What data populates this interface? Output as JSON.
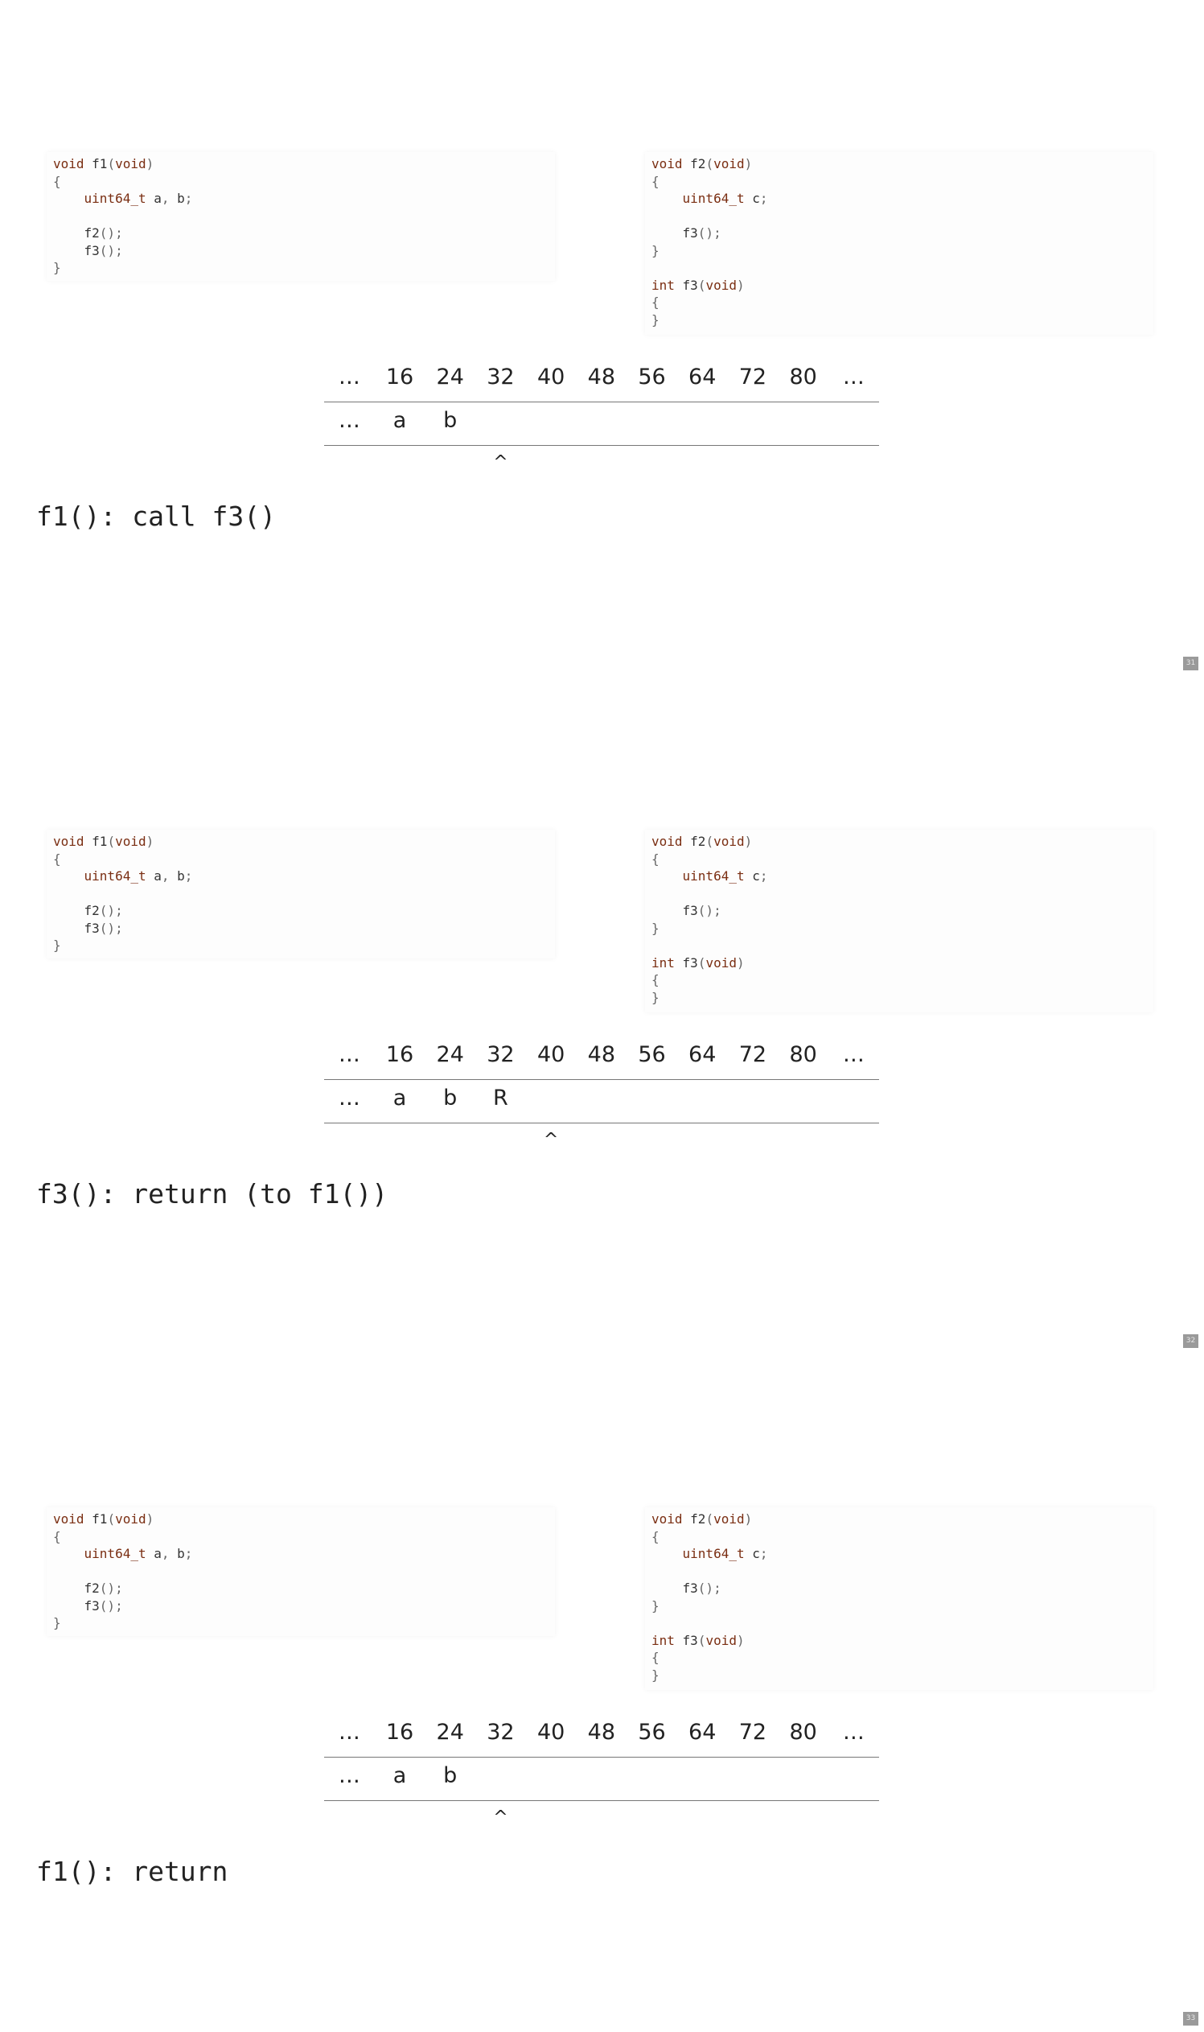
{
  "code": {
    "f1": [
      {
        "segs": [
          {
            "t": "void",
            "c": "kw"
          },
          {
            "t": " f1",
            "c": ""
          },
          {
            "t": "(",
            "c": "punc"
          },
          {
            "t": "void",
            "c": "kw"
          },
          {
            "t": ")",
            "c": "punc"
          }
        ]
      },
      {
        "segs": [
          {
            "t": "{",
            "c": "punc"
          }
        ]
      },
      {
        "segs": [
          {
            "t": "    ",
            "c": ""
          },
          {
            "t": "uint64_t",
            "c": "kw"
          },
          {
            "t": " a",
            "c": ""
          },
          {
            "t": ",",
            "c": "punc"
          },
          {
            "t": " b",
            "c": ""
          },
          {
            "t": ";",
            "c": "punc"
          }
        ]
      },
      {
        "segs": []
      },
      {
        "segs": [
          {
            "t": "    f2",
            "c": ""
          },
          {
            "t": "();",
            "c": "punc"
          }
        ]
      },
      {
        "segs": [
          {
            "t": "    f3",
            "c": ""
          },
          {
            "t": "();",
            "c": "punc"
          }
        ]
      },
      {
        "segs": [
          {
            "t": "}",
            "c": "punc"
          }
        ]
      }
    ],
    "f2f3": [
      {
        "segs": [
          {
            "t": "void",
            "c": "kw"
          },
          {
            "t": " f2",
            "c": ""
          },
          {
            "t": "(",
            "c": "punc"
          },
          {
            "t": "void",
            "c": "kw"
          },
          {
            "t": ")",
            "c": "punc"
          }
        ]
      },
      {
        "segs": [
          {
            "t": "{",
            "c": "punc"
          }
        ]
      },
      {
        "segs": [
          {
            "t": "    ",
            "c": ""
          },
          {
            "t": "uint64_t",
            "c": "kw"
          },
          {
            "t": " c",
            "c": ""
          },
          {
            "t": ";",
            "c": "punc"
          }
        ]
      },
      {
        "segs": []
      },
      {
        "segs": [
          {
            "t": "    f3",
            "c": ""
          },
          {
            "t": "();",
            "c": "punc"
          }
        ]
      },
      {
        "segs": [
          {
            "t": "}",
            "c": "punc"
          }
        ]
      },
      {
        "segs": []
      },
      {
        "segs": [
          {
            "t": "int",
            "c": "kw"
          },
          {
            "t": " f3",
            "c": ""
          },
          {
            "t": "(",
            "c": "punc"
          },
          {
            "t": "void",
            "c": "kw"
          },
          {
            "t": ")",
            "c": "punc"
          }
        ]
      },
      {
        "segs": [
          {
            "t": "{",
            "c": "punc"
          }
        ]
      },
      {
        "segs": [
          {
            "t": "}",
            "c": "punc"
          }
        ]
      }
    ]
  },
  "stack_header": [
    "…",
    "16",
    "24",
    "32",
    "40",
    "48",
    "56",
    "64",
    "72",
    "80",
    "…"
  ],
  "slides": [
    {
      "values": [
        "…",
        "a",
        "b",
        "",
        "",
        "",
        "",
        "",
        "",
        "",
        ""
      ],
      "pointer": "^",
      "pointer_index": 3,
      "caption": "f1(): call f3()",
      "page_number": "31"
    },
    {
      "values": [
        "…",
        "a",
        "b",
        "R",
        "",
        "",
        "",
        "",
        "",
        "",
        ""
      ],
      "pointer": "^",
      "pointer_index": 4,
      "caption": "f3(): return (to f1())",
      "page_number": "32"
    },
    {
      "values": [
        "…",
        "a",
        "b",
        "",
        "",
        "",
        "",
        "",
        "",
        "",
        ""
      ],
      "pointer": "^",
      "pointer_index": 3,
      "caption": "f1(): return",
      "page_number": "33"
    }
  ]
}
